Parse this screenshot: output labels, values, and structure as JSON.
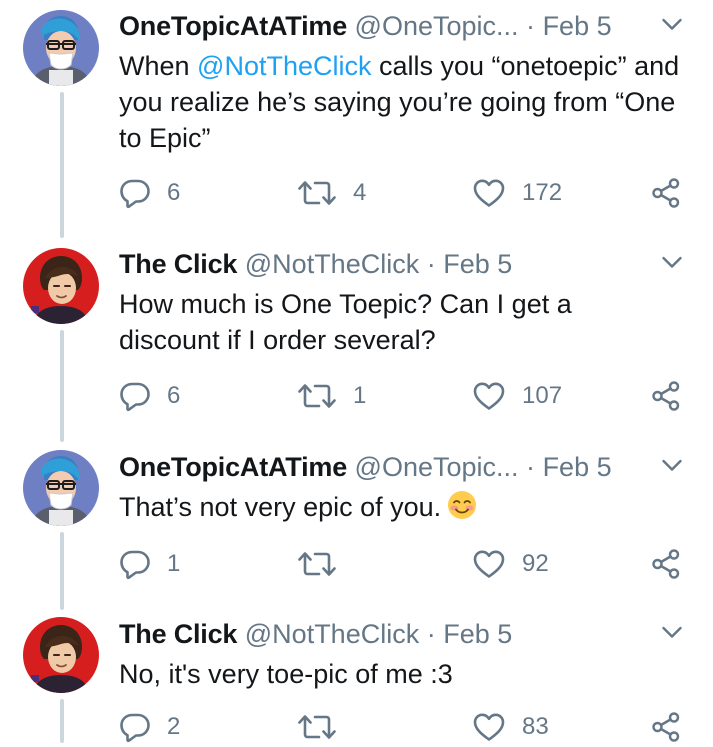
{
  "tweets": [
    {
      "name": "OneTopicAtATime",
      "handle": "@OneTopic...",
      "sep": "·",
      "date": "Feb 5",
      "text_pre": "When ",
      "mention": "@NotTheClick",
      "text_post": " calls you “onetoepic” and you realize he’s saying you’re going from “One to Epic”",
      "replies": "6",
      "retweets": "4",
      "likes": "172",
      "avatar": "blue-hair-masked-avatar"
    },
    {
      "name": "The Click",
      "handle": "@NotTheClick",
      "sep": "·",
      "date": "Feb 5",
      "text": "How much is One Toepic? Can I get a discount if I order several?",
      "replies": "6",
      "retweets": "1",
      "likes": "107",
      "avatar": "red-background-avatar"
    },
    {
      "name": "OneTopicAtATime",
      "handle": "@OneTopic...",
      "sep": "·",
      "date": "Feb 5",
      "text": "That’s not very epic of you.",
      "emoji": "smiling-face-emoji",
      "replies": "1",
      "retweets": "",
      "likes": "92",
      "avatar": "blue-hair-masked-avatar"
    },
    {
      "name": "The Click",
      "handle": "@NotTheClick",
      "sep": "·",
      "date": "Feb 5",
      "text": "No, it's very toe-pic of me :3",
      "replies": "2",
      "retweets": "",
      "likes": "83",
      "avatar": "red-background-avatar"
    }
  ],
  "colors": {
    "text": "#14171a",
    "secondary": "#657786",
    "link": "#1da1f2",
    "thread_line": "#ccd6dd"
  },
  "icons": [
    "reply-icon",
    "retweet-icon",
    "like-icon",
    "share-icon",
    "chevron-down-icon"
  ]
}
